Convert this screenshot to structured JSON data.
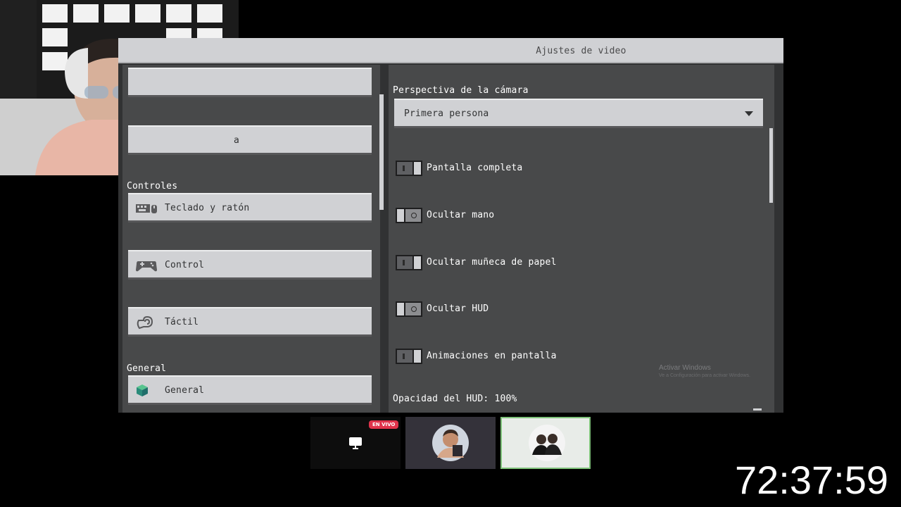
{
  "window": {
    "title": "Ajustes de video"
  },
  "left_panel": {
    "partial_button_text": "a",
    "sections": [
      {
        "heading": "Controles"
      },
      {
        "heading": "General"
      }
    ],
    "buttons": [
      {
        "label": "Teclado y ratón",
        "icon": "keyboard-mouse-icon"
      },
      {
        "label": "Control",
        "icon": "gamepad-icon"
      },
      {
        "label": "Táctil",
        "icon": "touch-icon"
      },
      {
        "label": "General",
        "icon": "cube-icon"
      }
    ]
  },
  "right_panel": {
    "camera_label": "Perspectiva de la cámara",
    "camera_value": "Primera persona",
    "toggles": [
      {
        "label": "Pantalla completa",
        "state": "on"
      },
      {
        "label": "Ocultar mano",
        "state": "off"
      },
      {
        "label": "Ocultar muñeca de papel",
        "state": "on"
      },
      {
        "label": "Ocultar HUD",
        "state": "off"
      },
      {
        "label": "Animaciones en pantalla",
        "state": "on"
      }
    ],
    "hud_opacity_label": "Opacidad del HUD: 100%"
  },
  "watermark": {
    "line1": "Activar Windows",
    "line2": "Ve a Configuración para activar Windows."
  },
  "stream": {
    "live_badge": "EN VIVO",
    "timer": "72:37:59"
  },
  "colors": {
    "panel": "#48494a",
    "button": "#d0d1d4",
    "live": "#e0334b",
    "active_tile_border": "#7fc27a"
  }
}
